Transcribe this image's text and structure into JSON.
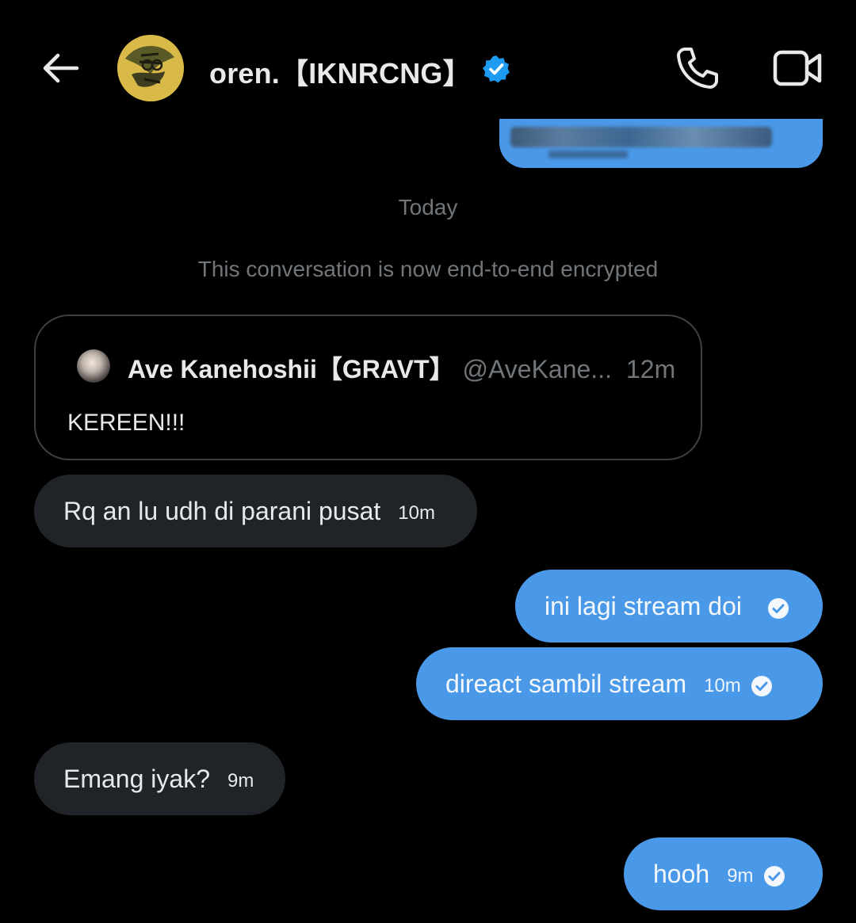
{
  "header": {
    "name": "oren.【IKNRCNG】",
    "verified": true,
    "back_icon": "arrow-left-icon",
    "call_icon": "phone-icon",
    "video_icon": "video-camera-icon"
  },
  "conversation": {
    "date_label": "Today",
    "system_message": "This conversation is now end-to-end encrypted"
  },
  "quoted_post": {
    "author_name": "Ave Kanehoshii【GRAVT】",
    "author_handle": "@AveKane...",
    "time": "12m",
    "text": "KEREEN!!!"
  },
  "messages": [
    {
      "direction": "incoming",
      "text": "Rq an lu udh di parani pusat",
      "time": "10m"
    },
    {
      "direction": "outgoing",
      "text": "ini lagi stream doi",
      "time": "",
      "status": "sent"
    },
    {
      "direction": "outgoing",
      "text": "direact sambil stream",
      "time": "10m",
      "status": "sent"
    },
    {
      "direction": "incoming",
      "text": "Emang iyak?",
      "time": "9m"
    },
    {
      "direction": "outgoing",
      "text": "hooh",
      "time": "9m",
      "status": "sent"
    }
  ],
  "colors": {
    "background": "#000000",
    "outgoing_bubble": "#4a99e9",
    "incoming_bubble": "#202327",
    "muted_text": "#71767b",
    "verified_badge": "#1d9bf0"
  }
}
